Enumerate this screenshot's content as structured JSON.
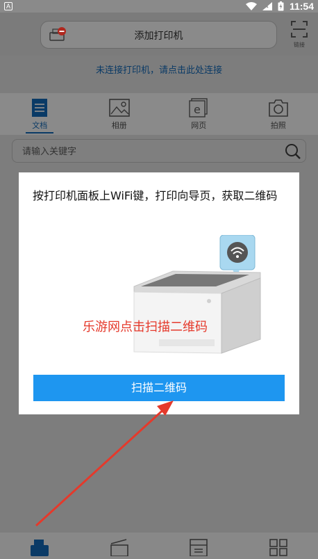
{
  "status_bar": {
    "time": "11:54",
    "left_badge": "A"
  },
  "header": {
    "add_printer_label": "添加打印机",
    "scan_label": "链接"
  },
  "connect_banner": {
    "text": "未连接打印机，请点击此处连接"
  },
  "tabs": [
    {
      "label": "文档",
      "icon": "document-icon",
      "active": true
    },
    {
      "label": "相册",
      "icon": "image-icon",
      "active": false
    },
    {
      "label": "网页",
      "icon": "webpage-icon",
      "active": false
    },
    {
      "label": "拍照",
      "icon": "camera-icon",
      "active": false
    }
  ],
  "search": {
    "placeholder": "请输入关键字"
  },
  "dialog": {
    "message": "按打印机面板上WiFi键，打印向导页，获取二维码",
    "watermark": "乐游网点击扫描二维码",
    "button_label": "扫描二维码"
  },
  "bottom_nav": [
    {
      "icon": "printer-tray-icon",
      "active": true
    },
    {
      "icon": "scan-doc-icon",
      "active": false
    },
    {
      "icon": "copy-icon",
      "active": false
    },
    {
      "icon": "apps-grid-icon",
      "active": false
    }
  ],
  "colors": {
    "accent": "#1e96f0",
    "annotation": "#e5392b",
    "overlay": "#7d7d7d"
  }
}
